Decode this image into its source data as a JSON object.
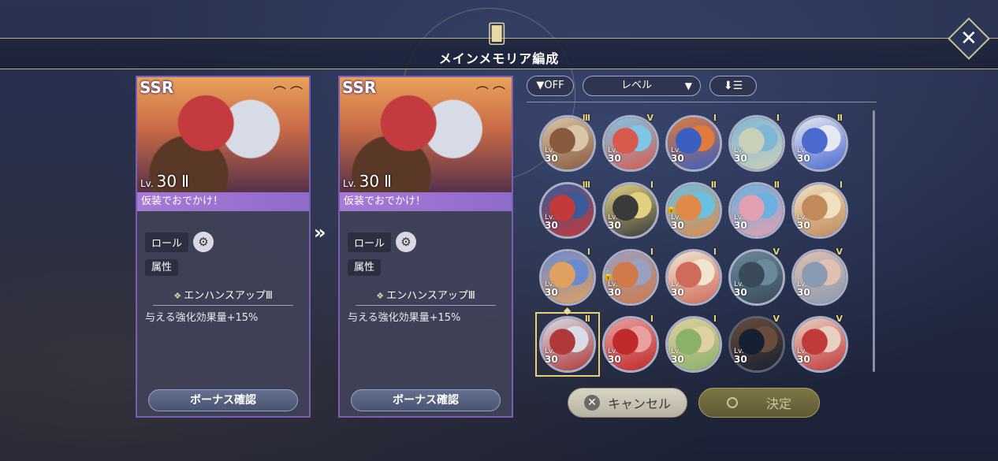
{
  "header": {
    "title": "メインメモリア編成",
    "close": "✕",
    "emblem": "🂠"
  },
  "cards": [
    {
      "rarity": "SSR",
      "bats": "⌒ ⌒",
      "level_prefix": "Lv.",
      "level": "30",
      "tier": "Ⅱ",
      "name": "仮装でおでかけ！",
      "role_label": "ロール",
      "role_icon": "⚙",
      "attribute_label": "属性",
      "skill_icon": "❖",
      "skill_name": "エンハンスアップⅢ",
      "skill_desc": "与える強化効果量+15%",
      "bonus_button": "ボーナス確認"
    },
    {
      "rarity": "SSR",
      "bats": "⌒ ⌒",
      "level_prefix": "Lv.",
      "level": "30",
      "tier": "Ⅱ",
      "name": "仮装でおでかけ！",
      "role_label": "ロール",
      "role_icon": "⚙",
      "attribute_label": "属性",
      "skill_icon": "❖",
      "skill_name": "エンハンスアップⅢ",
      "skill_desc": "与える強化効果量+15%",
      "bonus_button": "ボーナス確認"
    }
  ],
  "arrow": "»",
  "toolbar": {
    "filter": "▼OFF",
    "sort": "レベル",
    "sort_chevron": "▼",
    "order": "⬇☰"
  },
  "memories": [
    {
      "tier": "Ⅲ",
      "lv": "Lv.",
      "level": "30",
      "colors": [
        "#8a5a3e",
        "#d9c6a8"
      ]
    },
    {
      "tier": "Ⅴ",
      "lv": "Lv.",
      "level": "30",
      "colors": [
        "#d85a4e",
        "#7fc6e6"
      ]
    },
    {
      "tier": "Ⅰ",
      "lv": "Lv.",
      "level": "30",
      "colors": [
        "#3a5fc0",
        "#e07a3a"
      ]
    },
    {
      "tier": "Ⅰ",
      "lv": "Lv.",
      "level": "30",
      "colors": [
        "#c8d0b8",
        "#7fb6d6"
      ]
    },
    {
      "tier": "Ⅱ",
      "lv": "Lv.",
      "level": "30",
      "colors": [
        "#4a6ad0",
        "#e6e8f2"
      ]
    },
    {
      "tier": "Ⅲ",
      "lv": "Lv.",
      "level": "30",
      "colors": [
        "#c23a3a",
        "#3a5a9a"
      ]
    },
    {
      "tier": "Ⅰ",
      "lv": "Lv.",
      "level": "30",
      "colors": [
        "#3a3a3a",
        "#e0d080"
      ]
    },
    {
      "tier": "Ⅱ",
      "lv": "Lv.",
      "level": "30",
      "colors": [
        "#e08a4a",
        "#6ac0e0"
      ],
      "lock": true
    },
    {
      "tier": "Ⅱ",
      "lv": "Lv.",
      "level": "30",
      "colors": [
        "#e0a0b0",
        "#6ab0e0"
      ]
    },
    {
      "tier": "Ⅰ",
      "lv": "Lv.",
      "level": "30",
      "colors": [
        "#c08a5a",
        "#f0e0c0"
      ]
    },
    {
      "tier": "Ⅰ",
      "lv": "Lv.",
      "level": "30",
      "colors": [
        "#e0a060",
        "#6a8ad0"
      ]
    },
    {
      "tier": "Ⅰ",
      "lv": "Lv.",
      "level": "30",
      "colors": [
        "#d07a4a",
        "#9aa0c0"
      ],
      "lock": true
    },
    {
      "tier": "Ⅰ",
      "lv": "Lv.",
      "level": "30",
      "colors": [
        "#d06a5a",
        "#f0e6d0"
      ]
    },
    {
      "tier": "Ⅴ",
      "lv": "Lv.",
      "level": "30",
      "colors": [
        "#3a4a5a",
        "#6a8a9a"
      ]
    },
    {
      "tier": "Ⅴ",
      "lv": "Lv.",
      "level": "30",
      "colors": [
        "#8a9ab0",
        "#e0c0b0"
      ]
    },
    {
      "tier": "Ⅱ",
      "lv": "Lv.",
      "level": "30",
      "colors": [
        "#b03a3a",
        "#d8dce6"
      ],
      "selected": true
    },
    {
      "tier": "Ⅰ",
      "lv": "Lv.",
      "level": "30",
      "colors": [
        "#c02a2a",
        "#e8a0a0"
      ]
    },
    {
      "tier": "Ⅰ",
      "lv": "Lv.",
      "level": "30",
      "colors": [
        "#8ab06a",
        "#e0d0a0"
      ]
    },
    {
      "tier": "Ⅴ",
      "lv": "Lv.",
      "level": "30",
      "colors": [
        "#2a3a5a",
        "#c08a6a"
      ],
      "dim": true
    },
    {
      "tier": "Ⅴ",
      "lv": "Lv.",
      "level": "30",
      "colors": [
        "#c03a3a",
        "#e8d0c0"
      ]
    }
  ],
  "footer": {
    "cancel": "キャンセル",
    "cancel_icon": "✕",
    "confirm": "決定"
  }
}
